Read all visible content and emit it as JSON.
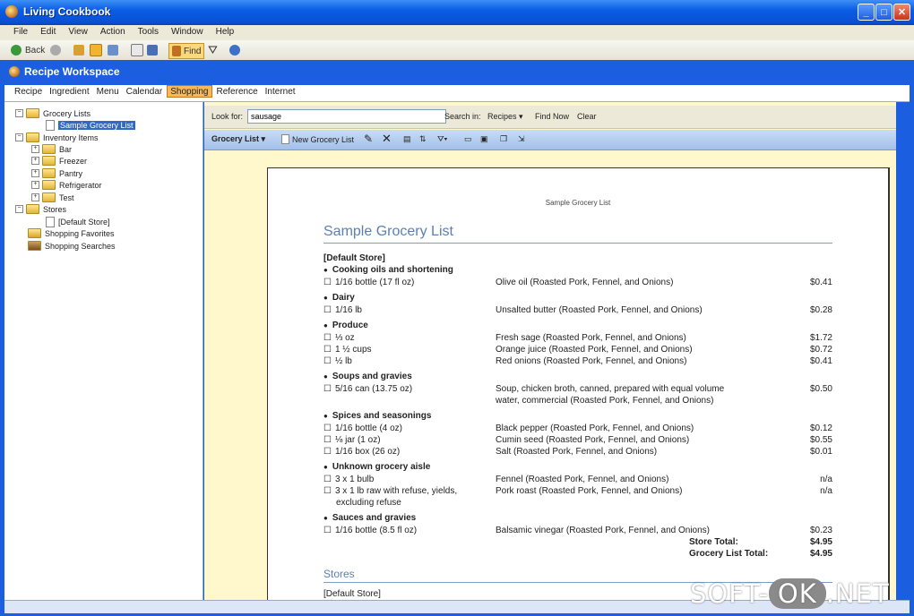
{
  "window": {
    "title": "Living Cookbook"
  },
  "menu": [
    "File",
    "Edit",
    "View",
    "Action",
    "Tools",
    "Window",
    "Help"
  ],
  "toolbar": {
    "back": "Back",
    "find": "Find"
  },
  "workspace": {
    "title": "Recipe Workspace"
  },
  "tabs": [
    "Recipe",
    "Ingredient",
    "Menu",
    "Calendar",
    "Shopping",
    "Reference",
    "Internet"
  ],
  "active_tab": "Shopping",
  "tree": {
    "grocery_lists": "Grocery Lists",
    "sample_grocery_list": "Sample Grocery List",
    "inventory_items": "Inventory Items",
    "inventory": [
      "Bar",
      "Freezer",
      "Pantry",
      "Refrigerator",
      "Test"
    ],
    "stores": "Stores",
    "default_store": "[Default Store]",
    "shopping_favorites": "Shopping Favorites",
    "shopping_searches": "Shopping Searches"
  },
  "search": {
    "look_for_label": "Look for:",
    "value": "sausage",
    "search_in_label": "Search in:",
    "search_in_value": "Recipes",
    "find_now": "Find Now",
    "clear": "Clear"
  },
  "grocery_toolbar": {
    "menu": "Grocery List",
    "new": "New Grocery List"
  },
  "document": {
    "header": "Sample Grocery List",
    "title": "Sample Grocery List",
    "store": "[Default Store]",
    "sections": [
      {
        "name": "Cooking oils and shortening",
        "items": [
          {
            "qty": "1/16 bottle (17 fl oz)",
            "desc": "Olive oil (Roasted Pork, Fennel, and Onions)",
            "price": "$0.41"
          }
        ]
      },
      {
        "name": "Dairy",
        "items": [
          {
            "qty": "1/16 lb",
            "desc": "Unsalted butter (Roasted Pork, Fennel, and Onions)",
            "price": "$0.28"
          }
        ]
      },
      {
        "name": "Produce",
        "items": [
          {
            "qty": "⅓ oz",
            "desc": "Fresh sage (Roasted Pork, Fennel, and Onions)",
            "price": "$1.72"
          },
          {
            "qty": "1 ½ cups",
            "desc": "Orange juice (Roasted Pork, Fennel, and Onions)",
            "price": "$0.72"
          },
          {
            "qty": "½ lb",
            "desc": "Red onions (Roasted Pork, Fennel, and Onions)",
            "price": "$0.41"
          }
        ]
      },
      {
        "name": "Soups and gravies",
        "items": [
          {
            "qty": "5/16 can (13.75 oz)",
            "desc": "Soup, chicken broth, canned, prepared with equal volume",
            "desc2": "water, commercial (Roasted Pork, Fennel, and Onions)",
            "price": "$0.50"
          }
        ]
      },
      {
        "name": "Spices and seasonings",
        "items": [
          {
            "qty": "1/16 bottle (4 oz)",
            "desc": "Black pepper (Roasted Pork, Fennel, and Onions)",
            "price": "$0.12"
          },
          {
            "qty": "⅛ jar (1 oz)",
            "desc": "Cumin seed (Roasted Pork, Fennel, and Onions)",
            "price": "$0.55"
          },
          {
            "qty": "1/16 box (26 oz)",
            "desc": "Salt (Roasted Pork, Fennel, and Onions)",
            "price": "$0.01"
          }
        ]
      },
      {
        "name": "Unknown grocery aisle",
        "items": [
          {
            "qty": "3 x 1 bulb",
            "desc": "Fennel (Roasted Pork, Fennel, and Onions)",
            "price": "n/a"
          },
          {
            "qty": "3 x 1 lb raw with refuse, yields,",
            "qty2": "excluding refuse",
            "desc": "Pork roast (Roasted Pork, Fennel, and Onions)",
            "price": "n/a"
          }
        ]
      },
      {
        "name": "Sauces and gravies",
        "items": [
          {
            "qty": "1/16 bottle (8.5 fl oz)",
            "desc": "Balsamic vinegar (Roasted Pork, Fennel, and Onions)",
            "price": "$0.23"
          }
        ]
      }
    ],
    "store_total_label": "Store Total:",
    "store_total": "$4.95",
    "grocery_total_label": "Grocery List Total:",
    "grocery_total": "$4.95",
    "stores_heading": "Stores",
    "stores_first": "[Default Store]"
  },
  "watermark": {
    "left": "SOFT-",
    "ok": "OK",
    "right": ".NET"
  }
}
